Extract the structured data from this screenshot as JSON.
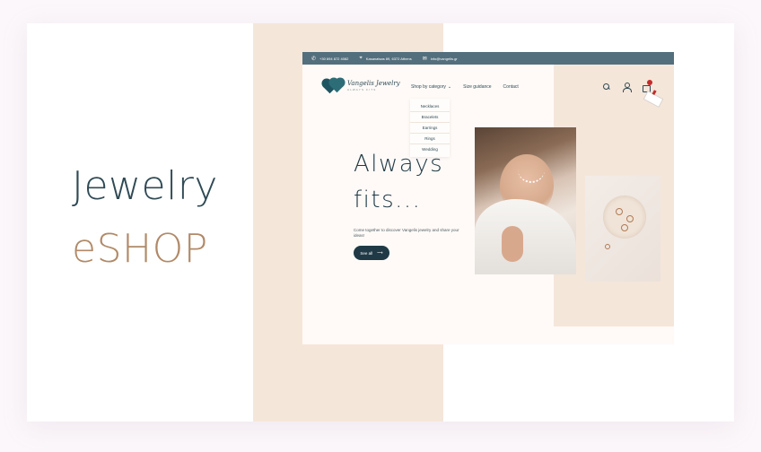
{
  "hero_left": {
    "line1": "Jewelry",
    "line2": "eSHOP"
  },
  "topbar": {
    "phone": "+30 694 872 4082",
    "address": "Kasanatsas 89, 6372 Athens",
    "email": "info@vangelis.gr"
  },
  "logo": {
    "name": "Vangelis Jewelry",
    "tagline": "ALWAYS FITS"
  },
  "nav": {
    "shop_by_category": "Shop by category",
    "size_guidance": "Size guidance",
    "contact": "Contact",
    "dropdown": [
      "Necklaces",
      "Bracelets",
      "Earrings",
      "Rings",
      "Wedding"
    ]
  },
  "hero": {
    "title_line1": "Always",
    "title_line2": "fits...",
    "subtitle": "Come together to discover Vangelis jewelry and share your ideas!",
    "cta": "See all"
  },
  "colors": {
    "accent_dark": "#1f3a46",
    "accent_brown": "#b08a68",
    "beige": "#f5e6da",
    "topbar": "#536f7d"
  },
  "icons": [
    "phone-icon",
    "location-icon",
    "mail-icon",
    "search-icon",
    "user-icon",
    "cart-icon",
    "arrow-right-icon",
    "chevron-down-icon"
  ]
}
